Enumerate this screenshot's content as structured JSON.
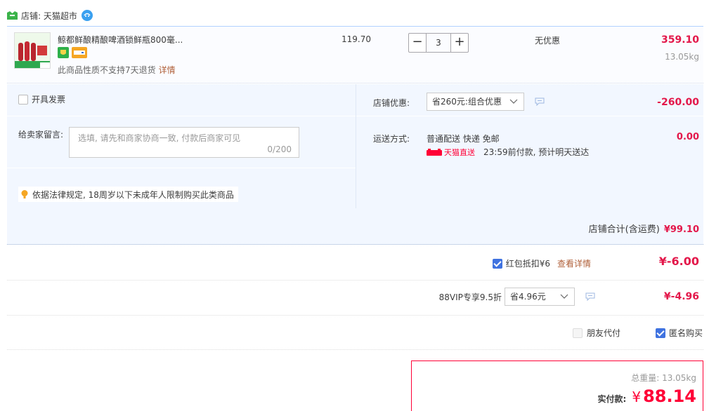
{
  "shop": {
    "label": "店铺: 天猫超市"
  },
  "item": {
    "title": "鲸都鲜酿精酿啤酒锁鲜瓶800毫...",
    "note": "此商品性质不支持7天退货",
    "note_link": "详情",
    "unit_price": "119.70",
    "quantity": "3",
    "minus": "−",
    "plus": "+",
    "discount": "无优惠",
    "total": "359.10",
    "weight": "13.05kg"
  },
  "invoice": {
    "label": "开具发票"
  },
  "message": {
    "label": "给卖家留言:",
    "placeholder": "选填, 请先和商家协商一致, 付款后商家可见",
    "count": "0/200"
  },
  "law_note": "依据法律规定, 18周岁以下未成年人限制购买此类商品",
  "shop_promo": {
    "label": "店铺优惠:",
    "selected": "省260元:组合优惠",
    "amount": "-260.00"
  },
  "shipping": {
    "label": "运送方式:",
    "method": "普通配送 快递 免邮",
    "tag": "天猫直送",
    "eta": "23:59前付款, 预计明天送达",
    "amount": "0.00"
  },
  "shop_total": {
    "label": "店铺合计(含运费)",
    "value": "¥99.10"
  },
  "red_packet": {
    "label": "红包抵扣¥6",
    "link": "查看详情",
    "amount": "¥-6.00"
  },
  "vip": {
    "label": "88VIP专享9.5折",
    "selected": "省4.96元",
    "amount": "¥-4.96"
  },
  "options": {
    "friend_pay": "朋友代付",
    "anonymous": "匿名购买"
  },
  "payment": {
    "weight_text": "总重量: 13.05kg",
    "label": "实付款:",
    "currency": "¥",
    "value": "88.14"
  },
  "colors": {
    "accent": "#e3174a",
    "pay_red": "#ff0036",
    "checkbox_blue": "#3f72e0",
    "panel_bg": "#f2f7ff"
  },
  "icons": [
    "tmall-shop-icon",
    "wangwang-icon",
    "minus-icon",
    "plus-icon",
    "chevron-down-icon",
    "chat-icon",
    "bulb-icon",
    "tmall-delivery-icon",
    "check-icon"
  ]
}
